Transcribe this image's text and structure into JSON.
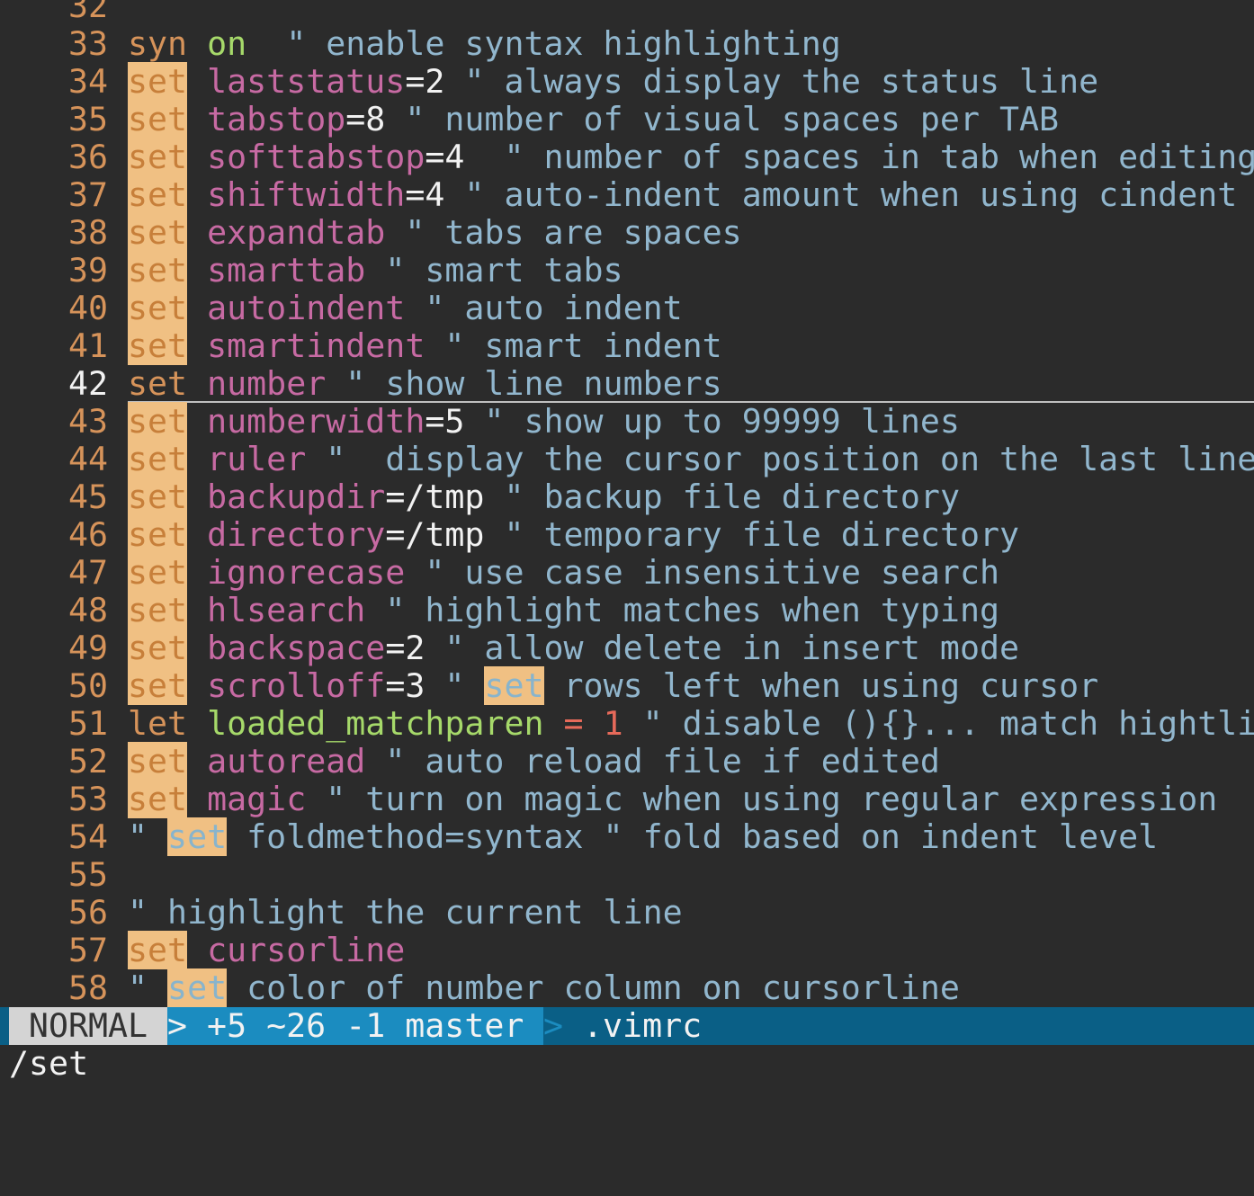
{
  "editor": {
    "lines": [
      {
        "nr": "32",
        "current": false,
        "tokens": []
      },
      {
        "nr": "33",
        "current": false,
        "tokens": [
          {
            "text": "syn",
            "cls": "t-stmt"
          },
          {
            "text": " ",
            "cls": ""
          },
          {
            "text": "on",
            "cls": "t-var"
          },
          {
            "text": "  \" enable syntax highlighting",
            "cls": "t-comment"
          }
        ]
      },
      {
        "nr": "34",
        "current": false,
        "tokens": [
          {
            "text": "set",
            "cls": "t-stmt hl"
          },
          {
            "text": " ",
            "cls": ""
          },
          {
            "text": "laststatus",
            "cls": "t-opt"
          },
          {
            "text": "=2",
            "cls": "t-plain"
          },
          {
            "text": " \" always display the status line",
            "cls": "t-comment"
          }
        ]
      },
      {
        "nr": "35",
        "current": false,
        "tokens": [
          {
            "text": "set",
            "cls": "t-stmt hl"
          },
          {
            "text": " ",
            "cls": ""
          },
          {
            "text": "tabstop",
            "cls": "t-opt"
          },
          {
            "text": "=8",
            "cls": "t-plain"
          },
          {
            "text": " \" number of visual spaces per TAB",
            "cls": "t-comment"
          }
        ]
      },
      {
        "nr": "36",
        "current": false,
        "tokens": [
          {
            "text": "set",
            "cls": "t-stmt hl"
          },
          {
            "text": " ",
            "cls": ""
          },
          {
            "text": "softtabstop",
            "cls": "t-opt"
          },
          {
            "text": "=4",
            "cls": "t-plain"
          },
          {
            "text": "  \" number of spaces in tab when editing",
            "cls": "t-comment"
          }
        ]
      },
      {
        "nr": "37",
        "current": false,
        "tokens": [
          {
            "text": "set",
            "cls": "t-stmt hl"
          },
          {
            "text": " ",
            "cls": ""
          },
          {
            "text": "shiftwidth",
            "cls": "t-opt"
          },
          {
            "text": "=4",
            "cls": "t-plain"
          },
          {
            "text": " \" auto-indent amount when using cindent",
            "cls": "t-comment"
          }
        ]
      },
      {
        "nr": "38",
        "current": false,
        "tokens": [
          {
            "text": "set",
            "cls": "t-stmt hl"
          },
          {
            "text": " ",
            "cls": ""
          },
          {
            "text": "expandtab",
            "cls": "t-opt"
          },
          {
            "text": " \" tabs are spaces",
            "cls": "t-comment"
          }
        ]
      },
      {
        "nr": "39",
        "current": false,
        "tokens": [
          {
            "text": "set",
            "cls": "t-stmt hl"
          },
          {
            "text": " ",
            "cls": ""
          },
          {
            "text": "smarttab",
            "cls": "t-opt"
          },
          {
            "text": " \" smart tabs",
            "cls": "t-comment"
          }
        ]
      },
      {
        "nr": "40",
        "current": false,
        "tokens": [
          {
            "text": "set",
            "cls": "t-stmt hl"
          },
          {
            "text": " ",
            "cls": ""
          },
          {
            "text": "autoindent",
            "cls": "t-opt"
          },
          {
            "text": " \" auto indent",
            "cls": "t-comment"
          }
        ]
      },
      {
        "nr": "41",
        "current": false,
        "tokens": [
          {
            "text": "set",
            "cls": "t-stmt hl"
          },
          {
            "text": " ",
            "cls": ""
          },
          {
            "text": "smartindent",
            "cls": "t-opt"
          },
          {
            "text": " \" smart indent",
            "cls": "t-comment"
          }
        ]
      },
      {
        "nr": "42",
        "current": true,
        "tokens": [
          {
            "text": "set",
            "cls": "t-stmt"
          },
          {
            "text": " ",
            "cls": ""
          },
          {
            "text": "number",
            "cls": "t-opt"
          },
          {
            "text": " \" show line numbers",
            "cls": "t-comment"
          }
        ]
      },
      {
        "nr": "43",
        "current": false,
        "tokens": [
          {
            "text": "set",
            "cls": "t-stmt hl"
          },
          {
            "text": " ",
            "cls": ""
          },
          {
            "text": "numberwidth",
            "cls": "t-opt"
          },
          {
            "text": "=5",
            "cls": "t-plain"
          },
          {
            "text": " \" show up to 99999 lines",
            "cls": "t-comment"
          }
        ]
      },
      {
        "nr": "44",
        "current": false,
        "tokens": [
          {
            "text": "set",
            "cls": "t-stmt hl"
          },
          {
            "text": " ",
            "cls": ""
          },
          {
            "text": "ruler",
            "cls": "t-opt"
          },
          {
            "text": " \"  display the cursor position on the last line",
            "cls": "t-comment"
          }
        ]
      },
      {
        "nr": "45",
        "current": false,
        "tokens": [
          {
            "text": "set",
            "cls": "t-stmt hl"
          },
          {
            "text": " ",
            "cls": ""
          },
          {
            "text": "backupdir",
            "cls": "t-opt"
          },
          {
            "text": "=/tmp",
            "cls": "t-plain"
          },
          {
            "text": " \" backup file directory",
            "cls": "t-comment"
          }
        ]
      },
      {
        "nr": "46",
        "current": false,
        "tokens": [
          {
            "text": "set",
            "cls": "t-stmt hl"
          },
          {
            "text": " ",
            "cls": ""
          },
          {
            "text": "directory",
            "cls": "t-opt"
          },
          {
            "text": "=/tmp",
            "cls": "t-plain"
          },
          {
            "text": " \" temporary file directory",
            "cls": "t-comment"
          }
        ]
      },
      {
        "nr": "47",
        "current": false,
        "tokens": [
          {
            "text": "set",
            "cls": "t-stmt hl"
          },
          {
            "text": " ",
            "cls": ""
          },
          {
            "text": "ignorecase",
            "cls": "t-opt"
          },
          {
            "text": " \" use case insensitive search",
            "cls": "t-comment"
          }
        ]
      },
      {
        "nr": "48",
        "current": false,
        "tokens": [
          {
            "text": "set",
            "cls": "t-stmt hl"
          },
          {
            "text": " ",
            "cls": ""
          },
          {
            "text": "hlsearch",
            "cls": "t-opt"
          },
          {
            "text": " \" highlight matches when typing",
            "cls": "t-comment"
          }
        ]
      },
      {
        "nr": "49",
        "current": false,
        "tokens": [
          {
            "text": "set",
            "cls": "t-stmt hl"
          },
          {
            "text": " ",
            "cls": ""
          },
          {
            "text": "backspace",
            "cls": "t-opt"
          },
          {
            "text": "=2",
            "cls": "t-plain"
          },
          {
            "text": " \" allow delete in insert mode",
            "cls": "t-comment"
          }
        ]
      },
      {
        "nr": "50",
        "current": false,
        "tokens": [
          {
            "text": "set",
            "cls": "t-stmt hl"
          },
          {
            "text": " ",
            "cls": ""
          },
          {
            "text": "scrolloff",
            "cls": "t-opt"
          },
          {
            "text": "=3",
            "cls": "t-plain"
          },
          {
            "text": " \" ",
            "cls": "t-comment"
          },
          {
            "text": "set",
            "cls": "t-stmt hl-c"
          },
          {
            "text": " rows left when using cursor",
            "cls": "t-comment"
          }
        ]
      },
      {
        "nr": "51",
        "current": false,
        "tokens": [
          {
            "text": "let",
            "cls": "t-stmt"
          },
          {
            "text": " ",
            "cls": ""
          },
          {
            "text": "loaded_matchparen",
            "cls": "t-var"
          },
          {
            "text": " = ",
            "cls": "t-op"
          },
          {
            "text": "1",
            "cls": "t-num"
          },
          {
            "text": " \" disable (){}... match hightlight",
            "cls": "t-comment"
          }
        ]
      },
      {
        "nr": "52",
        "current": false,
        "tokens": [
          {
            "text": "set",
            "cls": "t-stmt hl"
          },
          {
            "text": " ",
            "cls": ""
          },
          {
            "text": "autoread",
            "cls": "t-opt"
          },
          {
            "text": " \" auto reload file if edited",
            "cls": "t-comment"
          }
        ]
      },
      {
        "nr": "53",
        "current": false,
        "tokens": [
          {
            "text": "set",
            "cls": "t-stmt hl"
          },
          {
            "text": " ",
            "cls": ""
          },
          {
            "text": "magic",
            "cls": "t-opt"
          },
          {
            "text": " \" turn on magic when using regular expression",
            "cls": "t-comment"
          }
        ]
      },
      {
        "nr": "54",
        "current": false,
        "tokens": [
          {
            "text": "\" ",
            "cls": "t-comment"
          },
          {
            "text": "set",
            "cls": "t-stmt hl-c"
          },
          {
            "text": " foldmethod=syntax \" fold based on indent level",
            "cls": "t-comment"
          }
        ]
      },
      {
        "nr": "55",
        "current": false,
        "tokens": []
      },
      {
        "nr": "56",
        "current": false,
        "tokens": [
          {
            "text": "\" highlight the current line",
            "cls": "t-comment"
          }
        ]
      },
      {
        "nr": "57",
        "current": false,
        "tokens": [
          {
            "text": "set",
            "cls": "t-stmt hl"
          },
          {
            "text": " ",
            "cls": ""
          },
          {
            "text": "cursorline",
            "cls": "t-opt"
          }
        ]
      },
      {
        "nr": "58",
        "current": false,
        "tokens": [
          {
            "text": "\" ",
            "cls": "t-comment"
          },
          {
            "text": "set",
            "cls": "t-stmt hl-c"
          },
          {
            "text": " color of number column on cursorline",
            "cls": "t-comment"
          }
        ]
      }
    ]
  },
  "statusline": {
    "mode": "NORMAL",
    "vcs": "> +5 ~26 -1 master",
    "separator": ">",
    "filename": ".vimrc"
  },
  "cmdline": {
    "text": "/set"
  },
  "colors": {
    "background": "#2b2b2b",
    "statement": "#d6935a",
    "search_highlight": "#f0c083",
    "option": "#c76aa3",
    "comment": "#91b6cd",
    "variable": "#a6d96a",
    "number": "#e76a5a",
    "statusline_bg": "#0a5f86",
    "statusline_vcs_bg": "#1b8cc0",
    "mode_bg": "#d4d4d4"
  }
}
